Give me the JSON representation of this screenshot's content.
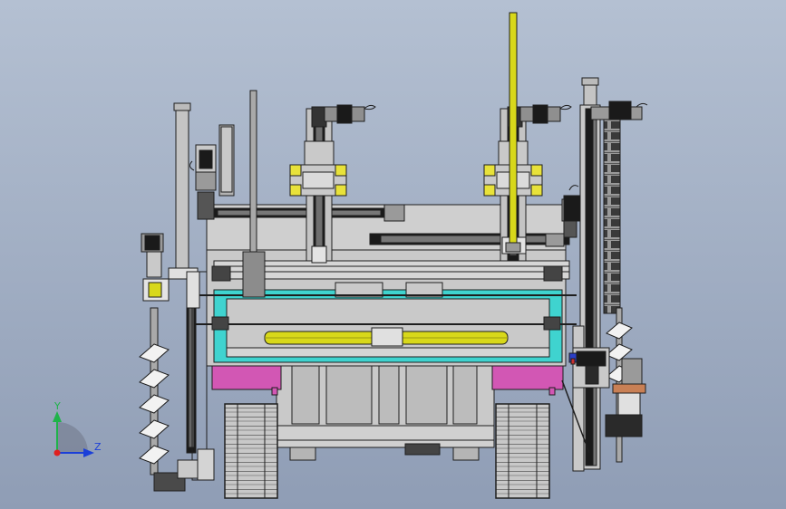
{
  "viewport": {
    "background_top": "#b4c0d2",
    "background_bottom": "#8f9db5"
  },
  "triad": {
    "y_label": "Y",
    "z_label": "Z",
    "y_color": "#1fb34a",
    "z_color": "#1b3fd8",
    "x_color": "#e02020"
  },
  "colors": {
    "frame_gray": "#c9c9c9",
    "frame_dark": "#7d7d7d",
    "frame_line": "#1e1e1e",
    "accent_cyan": "#3fd3cf",
    "accent_yellow": "#d8d81a",
    "accent_magenta": "#d257b4",
    "rail_black": "#1a1a1a",
    "track_gray": "#bdbdbd",
    "motor_gray": "#9a9a9a",
    "bracket_yellow": "#e8e23a",
    "rod_gray": "#a9a9a9",
    "copper": "#c98055",
    "blue_part": "#2b3fc7",
    "red_part": "#c83030"
  }
}
